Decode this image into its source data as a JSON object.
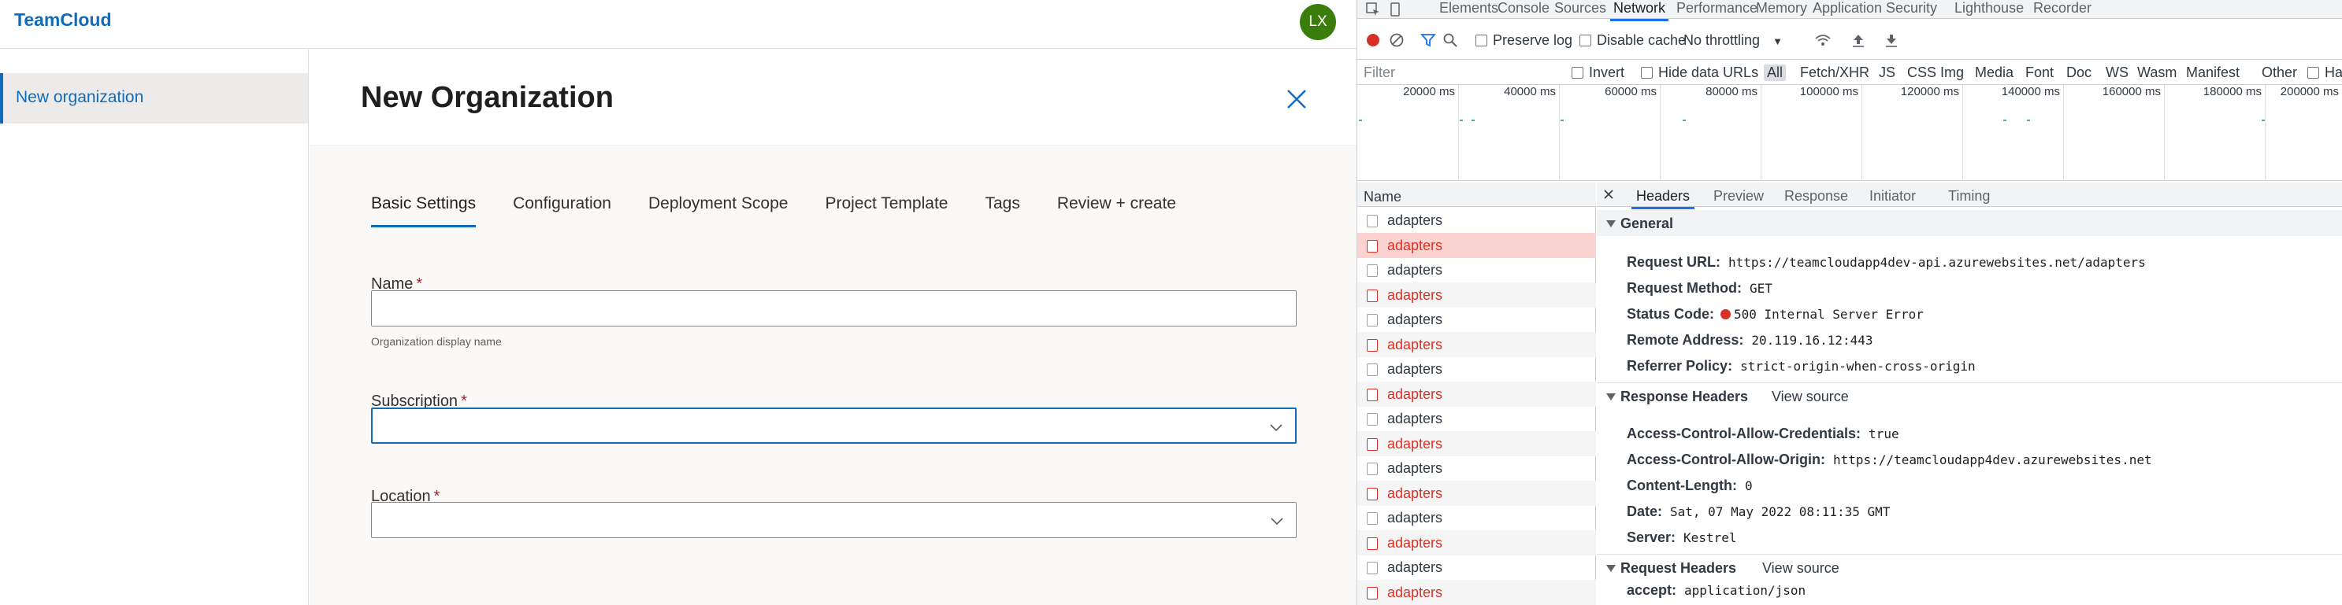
{
  "app": {
    "title": "TeamCloud",
    "avatar_initials": "LX",
    "sidebar": {
      "items": [
        {
          "label": "New organization"
        }
      ]
    },
    "page_title": "New Organization",
    "tabs": [
      {
        "label": "Basic Settings",
        "active": true
      },
      {
        "label": "Configuration",
        "active": false
      },
      {
        "label": "Deployment Scope",
        "active": false
      },
      {
        "label": "Project Template",
        "active": false
      },
      {
        "label": "Tags",
        "active": false
      },
      {
        "label": "Review + create",
        "active": false
      }
    ],
    "form": {
      "name": {
        "label": "Name",
        "required_mark": "*",
        "value": "",
        "hint": "Organization display name"
      },
      "subscription": {
        "label": "Subscription",
        "required_mark": "*",
        "value": ""
      },
      "location": {
        "label": "Location",
        "required_mark": "*",
        "value": ""
      }
    },
    "colors": {
      "accent": "#0f6cbd",
      "avatar": "#3a7d0a"
    }
  },
  "devtools": {
    "tabs": [
      "Elements",
      "Console",
      "Sources",
      "Network",
      "Performance",
      "Memory",
      "Application",
      "Security",
      "Lighthouse",
      "Recorder"
    ],
    "active_tab": "Network",
    "toolbar": {
      "preserve_log": "Preserve log",
      "disable_cache": "Disable cache",
      "throttling": "No throttling"
    },
    "filter": {
      "placeholder": "Filter",
      "invert": "Invert",
      "hide_data_urls": "Hide data URLs",
      "types": [
        "All",
        "Fetch/XHR",
        "JS",
        "CSS",
        "Img",
        "Media",
        "Font",
        "Doc",
        "WS",
        "Wasm",
        "Manifest",
        "Other"
      ],
      "active_type": "All",
      "has_blocked": "Ha"
    },
    "overview_ticks": [
      "20000 ms",
      "40000 ms",
      "60000 ms",
      "80000 ms",
      "100000 ms",
      "120000 ms",
      "140000 ms",
      "160000 ms",
      "180000 ms",
      "200000 ms"
    ],
    "request_list": {
      "header": "Name",
      "rows": [
        {
          "name": "adapters",
          "error": false
        },
        {
          "name": "adapters",
          "error": true,
          "selected": true
        },
        {
          "name": "adapters",
          "error": false
        },
        {
          "name": "adapters",
          "error": true
        },
        {
          "name": "adapters",
          "error": false
        },
        {
          "name": "adapters",
          "error": true
        },
        {
          "name": "adapters",
          "error": false
        },
        {
          "name": "adapters",
          "error": true
        },
        {
          "name": "adapters",
          "error": false
        },
        {
          "name": "adapters",
          "error": true
        },
        {
          "name": "adapters",
          "error": false
        },
        {
          "name": "adapters",
          "error": true
        },
        {
          "name": "adapters",
          "error": false
        },
        {
          "name": "adapters",
          "error": true
        },
        {
          "name": "adapters",
          "error": false
        },
        {
          "name": "adapters",
          "error": true
        }
      ]
    },
    "detail": {
      "tabs": [
        "Headers",
        "Preview",
        "Response",
        "Initiator",
        "Timing"
      ],
      "active_tab": "Headers",
      "general": {
        "title": "General",
        "rows": [
          {
            "k": "Request URL:",
            "v": "https://teamcloudapp4dev-api.azurewebsites.net/adapters"
          },
          {
            "k": "Request Method:",
            "v": "GET"
          },
          {
            "k": "Status Code:",
            "v": "500 Internal Server Error"
          },
          {
            "k": "Remote Address:",
            "v": "20.119.16.12:443"
          },
          {
            "k": "Referrer Policy:",
            "v": "strict-origin-when-cross-origin"
          }
        ]
      },
      "response_headers": {
        "title": "Response Headers",
        "view_source": "View source",
        "rows": [
          {
            "k": "Access-Control-Allow-Credentials:",
            "v": "true"
          },
          {
            "k": "Access-Control-Allow-Origin:",
            "v": "https://teamcloudapp4dev.azurewebsites.net"
          },
          {
            "k": "Content-Length:",
            "v": "0"
          },
          {
            "k": "Date:",
            "v": "Sat, 07 May 2022 08:11:35 GMT"
          },
          {
            "k": "Server:",
            "v": "Kestrel"
          }
        ]
      },
      "request_headers": {
        "title": "Request Headers",
        "view_source": "View source",
        "rows": [
          {
            "k": "accept:",
            "v": "application/json"
          }
        ]
      }
    }
  }
}
